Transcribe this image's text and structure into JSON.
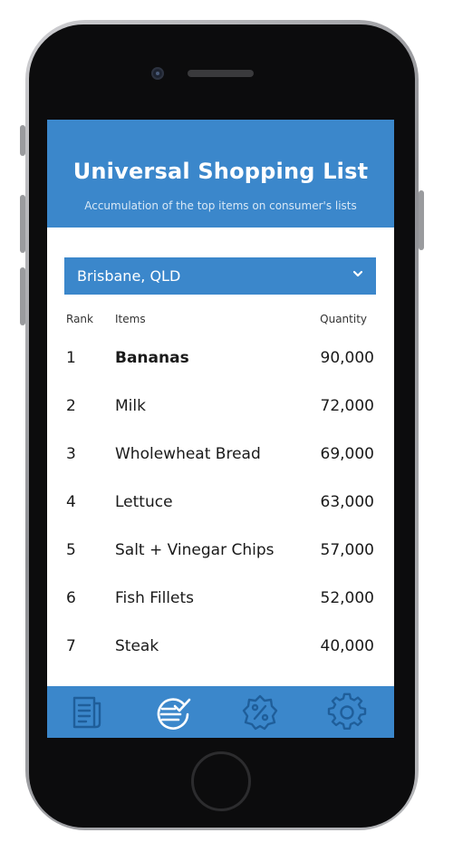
{
  "header": {
    "title": "Universal Shopping List",
    "subtitle": "Accumulation of the top items on consumer's lists"
  },
  "location_select": {
    "value": "Brisbane, QLD",
    "icon": "chevron-down-icon"
  },
  "table": {
    "columns": [
      "Rank",
      "Items",
      "Quantity"
    ],
    "rows": [
      {
        "rank": "1",
        "item": "Bananas",
        "quantity": "90,000"
      },
      {
        "rank": "2",
        "item": "Milk",
        "quantity": "72,000"
      },
      {
        "rank": "3",
        "item": "Wholewheat Bread",
        "quantity": "69,000"
      },
      {
        "rank": "4",
        "item": "Lettuce",
        "quantity": "63,000"
      },
      {
        "rank": "5",
        "item": "Salt + Vinegar Chips",
        "quantity": "57,000"
      },
      {
        "rank": "6",
        "item": "Fish Fillets",
        "quantity": "52,000"
      },
      {
        "rank": "7",
        "item": "Steak",
        "quantity": "40,000"
      }
    ]
  },
  "tab_bar": {
    "tabs": [
      {
        "icon": "receipt-icon",
        "active": false
      },
      {
        "icon": "checklist-icon",
        "active": true
      },
      {
        "icon": "discount-badge-icon",
        "active": false
      },
      {
        "icon": "gear-icon",
        "active": false
      }
    ]
  },
  "colors": {
    "accent": "#3b87cb",
    "icon_inactive": "#1f5e9a",
    "icon_active": "#ffffff"
  }
}
